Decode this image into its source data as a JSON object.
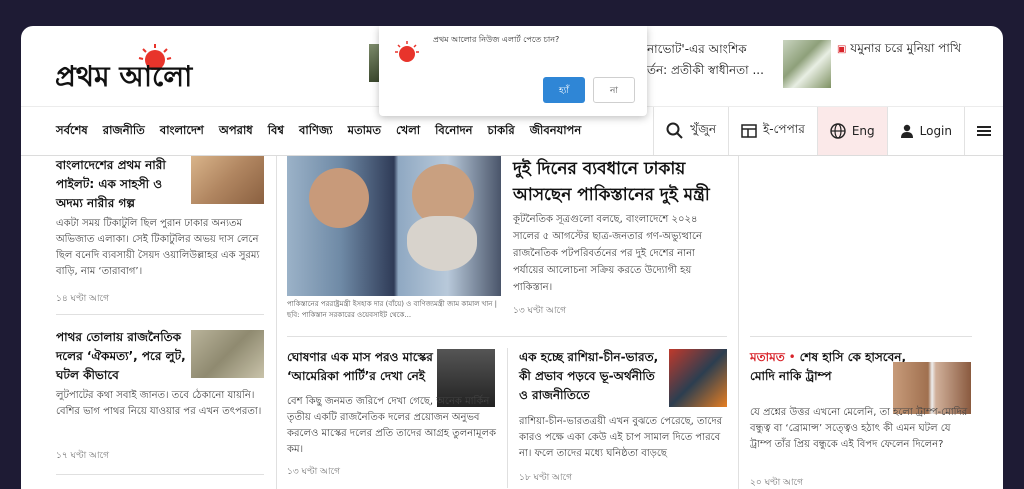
{
  "site": {
    "logo_text": "প্রথম আলো"
  },
  "trending": [
    {
      "text_line1": "নাভোট'-এর আংশিক",
      "text_line2": "র্তন: প্রতীকী স্বাধীনতা ..."
    },
    {
      "text": "যমুনার চরে মুনিয়া পাখি",
      "icon": "camera-icon"
    }
  ],
  "popup": {
    "message": "প্রথম আলোর নিউজ এলার্ট পেতে চান?",
    "yes_label": "হ্যাঁ",
    "no_label": "না"
  },
  "nav": {
    "items": [
      "সর্বশেষ",
      "রাজনীতি",
      "বাংলাদেশ",
      "অপরাধ",
      "বিশ্ব",
      "বাণিজ্য",
      "মতামত",
      "খেলা",
      "বিনোদন",
      "চাকরি",
      "জীবনযাপন"
    ],
    "search_label": "খুঁজুন",
    "epaper_label": "ই-পেপার",
    "eng_label": "Eng",
    "login_label": "Login",
    "icons": {
      "search": "search-icon",
      "epaper": "newspaper-icon",
      "language": "globe-icon",
      "login": "user-icon",
      "menu": "hamburger-menu-icon"
    }
  },
  "left_col": [
    {
      "title": "বাংলাদেশের প্রথম নারী পাইলট: এক সাহসী ও অদম্য নারীর গল্প",
      "excerpt": "একটা সময় টিকাটুলি ছিল পুরান ঢাকার অন্যতম অভিজাত এলাকা। সেই টিকাটুলির অভয় দাস লেনে ছিল বনেদি ব্যবসায়ী সৈয়দ ওয়ালিউল্লাহর এক সুরম্য বাড়ি, নাম ‘তারাবাগ’।",
      "time": "১৪ ঘণ্টা আগে"
    },
    {
      "title": "পাথর তোলায় রাজনৈতিক দলের ‘ঐকমত্য’, পরে লুট, ঘটল কীভাবে",
      "excerpt": "লুটপাটের কথা সবাই জানত। তবে ঠেকানো যায়নি। বেশির ভাগ পাথর নিয়ে যাওয়ার পর এখন তৎপরতা।",
      "time": "১৭ ঘণ্টা আগে"
    }
  ],
  "lead": {
    "title": "দুই দিনের ব্যবধানে ঢাকায় আসছেন পাকিস্তানের দুই মন্ত্রী",
    "excerpt": "কূটনৈতিক সূত্রগুলো বলছে, বাংলাদেশে ২০২৪ সালের ৫ আগস্টের ছাত্র-জনতার গণ-অভ্যুত্থানে রাজনৈতিক পটপরিবর্তনের পর দুই দেশের নানা পর্যায়ের আলোচনা সক্রিয় করতে উদ্যোগী হয় পাকিস্তান।",
    "time": "১৩ ঘণ্টা আগে",
    "caption": "পাকিস্তানের পররাষ্ট্রমন্ত্রী ইসহাক দার (বাঁয়ে) ও বাণিজ্যমন্ত্রী জাম কামাল খান | ছবি: পাকিস্তান সরকারের ওয়েবসাইট থেকে..."
  },
  "mid_stories": [
    {
      "title": "ঘোষণার এক মাস পরও মাস্কের ‘আমেরিকা পার্টি’র দেখা নেই",
      "excerpt": "বেশ কিছু জনমত জরিপে দেখা গেছে, অনেক মার্কিন তৃতীয় একটি রাজনৈতিক দলের প্রয়োজন অনুভব করলেও মাস্কের দলের প্রতি তাদের আগ্রহ তুলনামূলক কম।",
      "time": "১৩ ঘণ্টা আগে"
    },
    {
      "title": "এক হচ্ছে রাশিয়া-চীন-ভারত, কী প্রভাব পড়বে ভূ-অর্থনীতি ও রাজনীতিতে",
      "excerpt": "রাশিয়া-চীন-ভারতত্রয়ী এখন বুঝতে পেরেছে, তাদের কারও পক্ষে একা কেউ এই চাপ সামাল দিতে পারবে না। ফলে তাদের মধ্যে ঘনিষ্ঠতা বাড়ছে",
      "time": "১৮ ঘণ্টা আগে"
    }
  ],
  "right_story": {
    "tag": "মতামত",
    "title": "শেষ হাসি কে হাসবেন, মোদি নাকি ট্রাম্প",
    "excerpt": "যে প্রশ্নের উত্তর এখনো মেলেনি, তা হলো ট্রাম্প-মোদির বন্ধুত্ব বা ‘ব্রোমান্স’ সত্ত্বেও হঠাৎ কী এমন ঘটল যে ট্রাম্প তাঁর প্রিয় বন্ধুকে এই বিপদ ফেলেন দিলেন?",
    "time": "২০ ঘণ্টা আগে"
  },
  "colors": {
    "brand_red": "#e8342b",
    "tag_red": "#d8232a",
    "bg_dark": "#1e1b34",
    "popup_blue": "#2f86d6"
  }
}
